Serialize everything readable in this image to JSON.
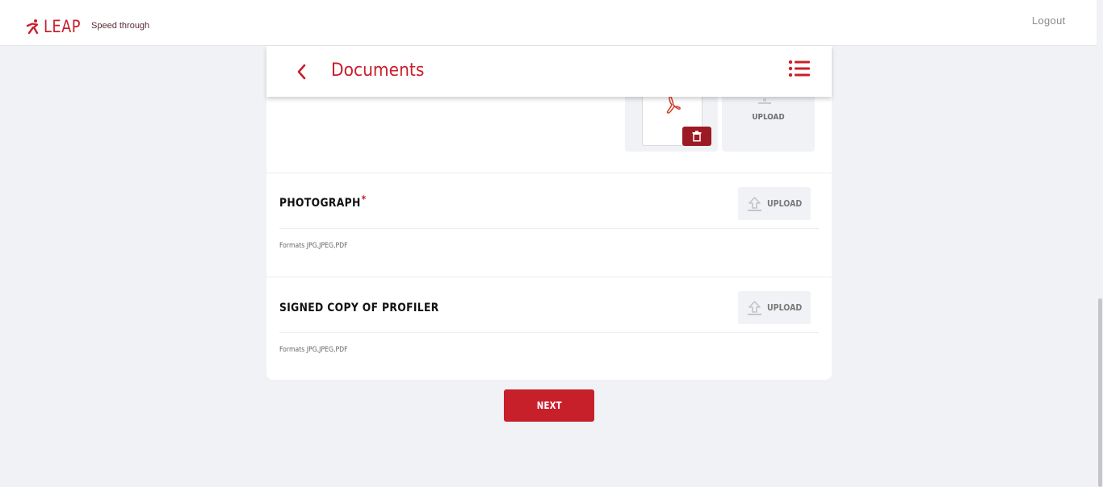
{
  "brand": {
    "name": "LEAP",
    "tagline": "Speed through",
    "color": "#c8202b"
  },
  "header": {
    "logout_label": "Logout"
  },
  "page": {
    "title": "Documents"
  },
  "first_section": {
    "upload_label": "UPLOAD",
    "file_type_icon": "pdf-icon",
    "delete_icon": "trash-icon"
  },
  "sections": [
    {
      "title": "PHOTOGRAPH",
      "required_mark": "*",
      "upload_label": "UPLOAD",
      "formats": "Formats JPG,JPEG,PDF"
    },
    {
      "title": "SIGNED COPY OF PROFILER",
      "upload_label": "UPLOAD",
      "formats": "Formats JPG,JPEG,PDF"
    }
  ],
  "footer": {
    "next_label": "NEXT"
  }
}
